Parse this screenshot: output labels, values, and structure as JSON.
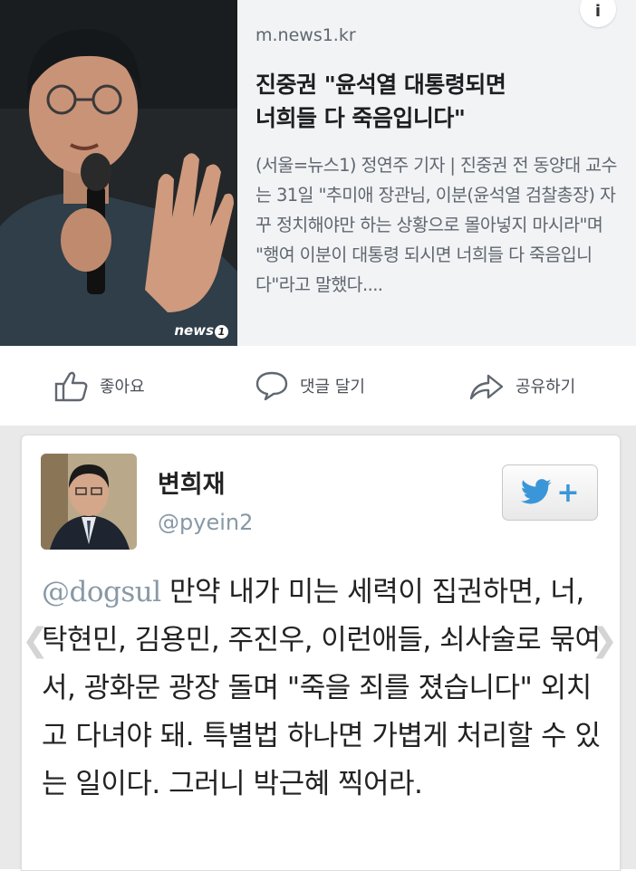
{
  "card": {
    "domain": "m.news1.kr",
    "headline_line1": "진중권 \"윤석열 대통령되면",
    "headline_line2": "너희들 다 죽음입니다\"",
    "excerpt": "(서울=뉴스1) 정연주 기자 | 진중권 전 동양대 교수는 31일 \"추미애 장관님, 이분(윤석열 검찰총장) 자꾸 정치해야만 하는 상황으로 몰아넣지 마시라\"며 \"행여 이분이 대통령 되시면 너희들 다 죽음입니다\"라고 말했다....",
    "watermark": "news",
    "watermark_mark": "1",
    "info_icon_glyph": "i"
  },
  "actions": {
    "like": "좋아요",
    "comment": "댓글 달기",
    "share": "공유하기"
  },
  "tweet": {
    "name": "변희재",
    "handle": "@pyein2",
    "follow_plus": "+",
    "mention": "@dogsul",
    "body": " 만약 내가 미는 세력이 집권하면, 너, 탁현민, 김용민, 주진우, 이런애들, 쇠사술로 묶여서, 광화문 광장 돌며 \"죽을 죄를 졌습니다\" 외치고 다녀야 돼. 특별법 하나면 가볍게 처리할 수 있는 일이다. 그러니 박근혜 찍어라.",
    "chevron_left": "❮",
    "chevron_right": "❯"
  },
  "colors": {
    "card_bg": "#f2f3f5",
    "twitter_blue": "#3a96d8",
    "muted_text": "#606770"
  }
}
